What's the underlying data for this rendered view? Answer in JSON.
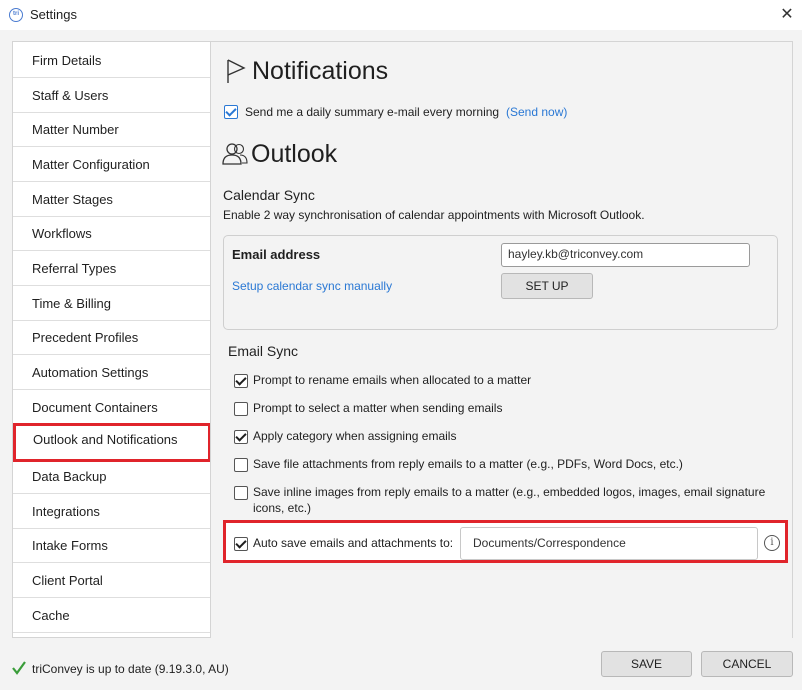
{
  "window": {
    "title": "Settings",
    "app_icon_text": "tri",
    "close_glyph": "✕"
  },
  "sidebar": {
    "items": [
      {
        "label": "Firm Details"
      },
      {
        "label": "Staff & Users"
      },
      {
        "label": "Matter Number"
      },
      {
        "label": "Matter Configuration"
      },
      {
        "label": "Matter Stages"
      },
      {
        "label": "Workflows"
      },
      {
        "label": "Referral Types"
      },
      {
        "label": "Time & Billing"
      },
      {
        "label": "Precedent Profiles"
      },
      {
        "label": "Automation Settings"
      },
      {
        "label": "Document Containers"
      },
      {
        "label": "Outlook and Notifications"
      },
      {
        "label": "Data Backup"
      },
      {
        "label": "Integrations"
      },
      {
        "label": "Intake Forms"
      },
      {
        "label": "Client Portal"
      },
      {
        "label": "Cache"
      }
    ],
    "active_index": 11
  },
  "notifications": {
    "heading": "Notifications",
    "daily_summary_label": "Send me a daily summary e-mail every morning",
    "daily_summary_checked": true,
    "send_now_link": "(Send now)"
  },
  "outlook": {
    "heading": "Outlook",
    "calendar_sync": {
      "title": "Calendar Sync",
      "description": "Enable 2 way synchronisation of calendar appointments with Microsoft Outlook.",
      "email_label": "Email address",
      "email_value": "hayley.kb@triconvey.com",
      "manual_link": "Setup calendar sync manually",
      "setup_button": "SET UP"
    },
    "email_sync": {
      "title": "Email Sync",
      "options": [
        {
          "label": "Prompt to rename emails when allocated to a matter",
          "checked": true
        },
        {
          "label": "Prompt to select a matter when sending emails",
          "checked": false
        },
        {
          "label": "Apply category when assigning emails",
          "checked": true
        },
        {
          "label": "Save file attachments from reply emails to a matter (e.g., PDFs, Word Docs, etc.)",
          "checked": false
        },
        {
          "label": "Save inline images from reply emails to a matter (e.g., embedded logos, images, email signature",
          "label_line2": "icons, etc.)",
          "checked": false
        }
      ],
      "auto_save_label": "Auto save emails and attachments to:",
      "auto_save_checked": true,
      "auto_save_path": "Documents/Correspondence",
      "info_glyph": "i"
    }
  },
  "footer": {
    "status_text": "triConvey is up to date (9.19.3.0, AU)",
    "save_button": "SAVE",
    "cancel_button": "CANCEL"
  },
  "colors": {
    "highlight": "#e0242b",
    "link": "#2a78d4",
    "success": "#3a9d3a"
  }
}
